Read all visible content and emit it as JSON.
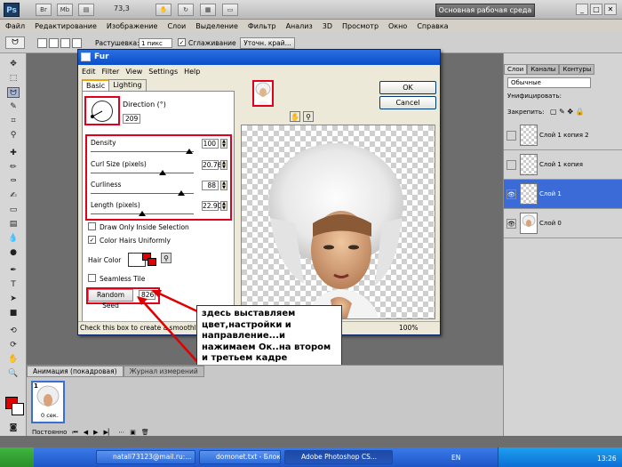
{
  "app": {
    "logo_text": "Ps",
    "zoom": "73,3",
    "workspace": "Основная рабочая среда"
  },
  "menubar": {
    "items": [
      "Файл",
      "Редактирование",
      "Изображение",
      "Слои",
      "Выделение",
      "Фильтр",
      "Анализ",
      "3D",
      "Просмотр",
      "Окно",
      "Справка"
    ]
  },
  "options_bar": {
    "feather_label": "Растушевка:",
    "feather_value": "1 пикс",
    "antialias_label": "Сглаживание",
    "refine_button": "Уточн. край..."
  },
  "fur_dialog": {
    "title": "Fur",
    "menu": [
      "Edit",
      "Filter",
      "View",
      "Settings",
      "Help"
    ],
    "tabs": [
      "Basic",
      "Lighting"
    ],
    "direction_label": "Direction (°)",
    "direction_value": "209",
    "sliders": [
      {
        "label": "Density",
        "value": "100",
        "level": 0.96
      },
      {
        "label": "Curl Size (pixels)",
        "value": "20.76",
        "level": 0.7
      },
      {
        "label": "Curliness",
        "value": "88",
        "level": 0.88
      },
      {
        "label": "Length (pixels)",
        "value": "22.90",
        "level": 0.5
      }
    ],
    "draw_only_label": "Draw Only Inside Selection",
    "color_uniform_label": "Color Hairs Uniformly",
    "hair_color_label": "Hair Color",
    "seamless_label": "Seamless Tile",
    "random_seed_button": "Random Seed",
    "random_seed_value": "826",
    "ok_button": "OK",
    "cancel_button": "Cancel",
    "status_text": "Check this box to create a smoothly rep",
    "zoom": "100%"
  },
  "callout": {
    "text": "здесь выставляем цвет,настройки и направление...и нажимаем Ок..на втором и третьем кадре нажимаем -рендом сид"
  },
  "animation_panel": {
    "tabs": [
      "Анимация (покадровая)",
      "Журнал измерений"
    ],
    "frame_number": "1",
    "frame_time": "0 сек.",
    "loop": "Постоянно"
  },
  "layers_panel": {
    "tabs": [
      "Слои",
      "Каналы",
      "Контуры"
    ],
    "blend_mode": "Обычные",
    "unify_label": "Унифицировать:",
    "lock_label": "Закрепить:",
    "layers": [
      {
        "name": "Слой 1 копия 2",
        "visible": false,
        "selected": false
      },
      {
        "name": "Слой 1 копия",
        "visible": false,
        "selected": false
      },
      {
        "name": "Слой 1",
        "visible": true,
        "selected": true
      },
      {
        "name": "Слой 0",
        "visible": true,
        "selected": false
      }
    ]
  },
  "taskbar": {
    "buttons": [
      "natali73123@mail.ru:...",
      "domonet.txt - Блокнот",
      "Adobe Photoshop CS..."
    ],
    "lang": "EN",
    "time": "13:26"
  },
  "colors": {
    "accent_red": "#e00000",
    "xp_blue": "#1f56c7",
    "selection_blue": "#3b6bd6"
  }
}
